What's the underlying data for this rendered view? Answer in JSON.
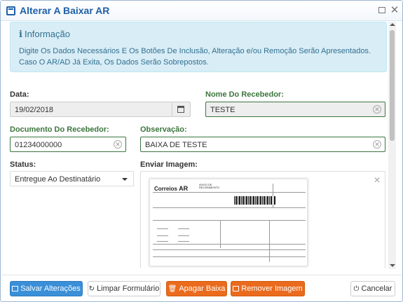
{
  "window": {
    "title": "Alterar A Baixar AR"
  },
  "info": {
    "title": "Informação",
    "text": "Digite Os Dados Necessários E Os Botões De Inclusão, Alteração e/ou Remoção Serão Apresentados. Caso O AR/AD Já Exita, Os Dados Serão Sobrepostos."
  },
  "form": {
    "data_label": "Data:",
    "data_value": "19/02/2018",
    "recebedor_label": "Nome Do Recebedor:",
    "recebedor_value": "TESTE",
    "documento_label": "Documento Do Recebedor:",
    "documento_value": "01234000000",
    "observacao_label": "Observação:",
    "observacao_value": "BAIXA DE TESTE",
    "status_label": "Status:",
    "status_value": "Entregue Ao Destinatário",
    "imagem_label": "Enviar Imagem:"
  },
  "doc": {
    "logo": "Correios",
    "logo_ar": "AR",
    "header_line1": "AVISO DE",
    "header_line2": "RECEBIMENTO"
  },
  "footer": {
    "save": "Salvar Alterações",
    "clear": "Limpar Formulário",
    "delete": "Apagar Baixa",
    "remove_image": "Remover Imagem",
    "cancel": "Cancelar"
  },
  "colors": {
    "primary": "#3a8fd8",
    "warning": "#ea6b1d",
    "success": "#3c763d",
    "info_bg": "#d9edf7",
    "title": "#1f5fa8"
  },
  "icons": [
    "window-icon",
    "maximize-icon",
    "close-icon",
    "info-icon",
    "calendar-icon",
    "clear-icon",
    "caret-down-icon",
    "remove-image-icon",
    "save-icon",
    "refresh-icon",
    "trash-icon",
    "image-icon",
    "power-icon"
  ]
}
